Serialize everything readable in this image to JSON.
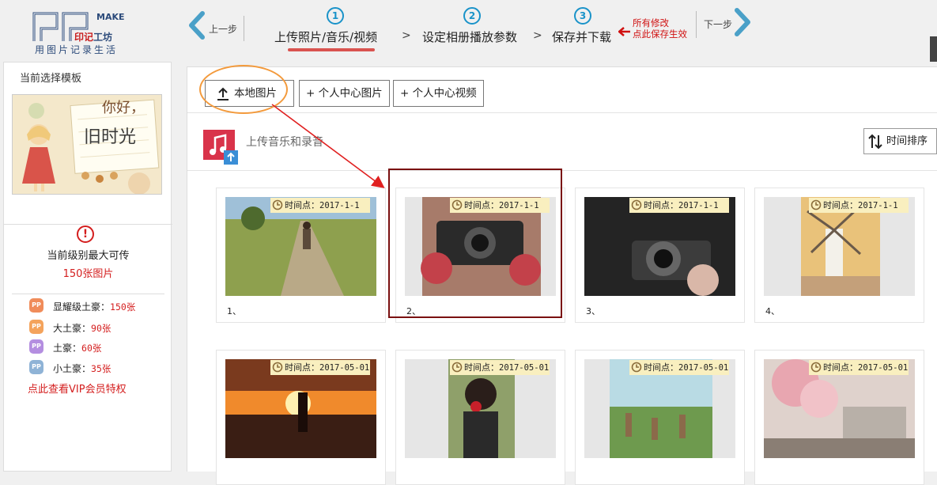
{
  "header": {
    "logo": {
      "make": "MAKE",
      "brand_a": "印记",
      "brand_b": "工坊",
      "slogan": "用图片记录生活"
    },
    "prev_label": "上一步",
    "next_label": "下一步",
    "steps": [
      {
        "num": "1",
        "label": "上传照片/音乐/视频",
        "active": true
      },
      {
        "num": "2",
        "label": "设定相册播放参数",
        "active": false
      },
      {
        "num": "3",
        "label": "保存并下载",
        "active": false
      }
    ],
    "step_separator": ">",
    "save_note_line1": "所有修改",
    "save_note_line2": "点此保存生效",
    "accent_color": "#1a93c9",
    "active_color": "#d9534f"
  },
  "sidebar": {
    "title": "当前选择模板",
    "template_text_a": "你好，",
    "template_text_b": "旧时光",
    "max_label": "当前级别最大可传",
    "max_value": "150张图片",
    "levels": [
      {
        "name": "显耀级土豪：",
        "value": "150张",
        "color": "#f08c5a"
      },
      {
        "name": "大土豪：",
        "value": "90张",
        "color": "#f4a35c"
      },
      {
        "name": "土豪：",
        "value": "60张",
        "color": "#b48ee0"
      },
      {
        "name": "小土豪：",
        "value": "35张",
        "color": "#8fb3d6"
      }
    ],
    "badge_text": "PP",
    "vip_link": "点此查看VIP会员特权"
  },
  "toolbar": {
    "local_images": "本地图片",
    "personal_images": "+ 个人中心图片",
    "personal_videos": "+ 个人中心视频",
    "upload_music": "上传音乐和录音",
    "sort_time": "时间排序"
  },
  "photos": [
    {
      "index": "1、",
      "time_label": "时间点：",
      "time_value": "2017-1-1",
      "scene": "field-road"
    },
    {
      "index": "2、",
      "time_label": "时间点：",
      "time_value": "2017-1-1",
      "scene": "camera-red"
    },
    {
      "index": "3、",
      "time_label": "时间点：",
      "time_value": "2017-1-1",
      "scene": "camera-dark"
    },
    {
      "index": "4、",
      "time_label": "时间点：",
      "time_value": "2017-1-1",
      "scene": "windmill"
    },
    {
      "index": "",
      "time_label": "时间点：",
      "time_value": "2017-05-01",
      "scene": "sunset-beach"
    },
    {
      "index": "",
      "time_label": "时间点：",
      "time_value": "2017-05-01",
      "scene": "girl-rose"
    },
    {
      "index": "",
      "time_label": "时间点：",
      "time_value": "2017-05-01",
      "scene": "garden"
    },
    {
      "index": "",
      "time_label": "时间点：",
      "time_value": "2017-05-01",
      "scene": "blossom-street"
    }
  ],
  "selected_photo": 2
}
